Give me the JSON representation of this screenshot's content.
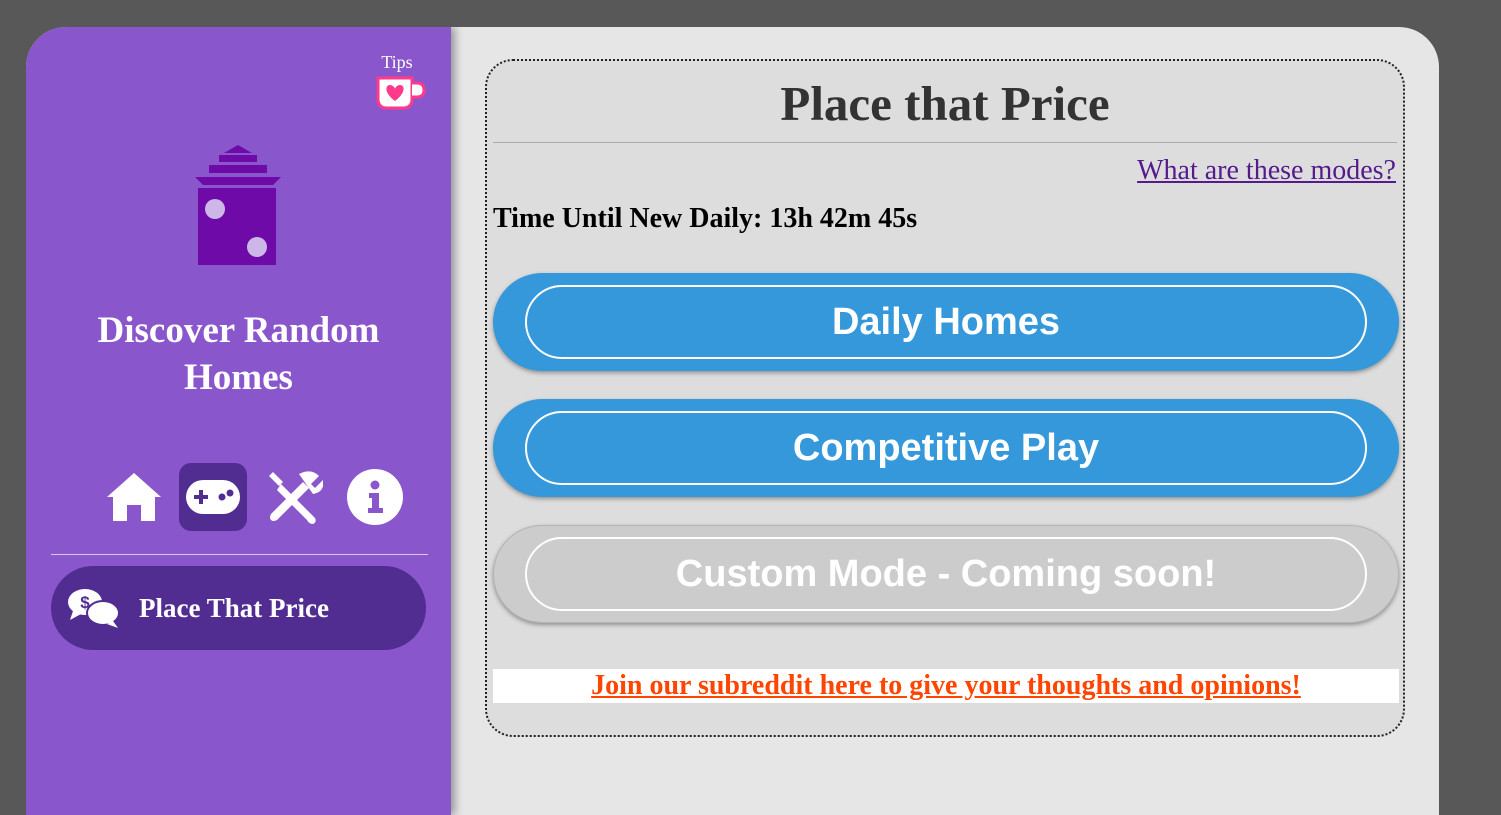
{
  "sidebar": {
    "tips_label": "Tips",
    "site_title_line1": "Discover Random",
    "site_title_line2": "Homes",
    "nav": [
      {
        "name": "home",
        "icon": "home-icon"
      },
      {
        "name": "games",
        "icon": "gamepad-icon",
        "active": true
      },
      {
        "name": "tools",
        "icon": "tools-icon"
      },
      {
        "name": "info",
        "icon": "info-icon"
      }
    ],
    "game_link": {
      "label": "Place That Price",
      "icon": "price-chat-icon"
    }
  },
  "main": {
    "title": "Place that Price",
    "modes_link": "What are these modes?",
    "timer": "Time Until New Daily: 13h 42m 45s",
    "buttons": [
      {
        "label": "Daily Homes",
        "state": "enabled"
      },
      {
        "label": "Competitive Play",
        "state": "enabled"
      },
      {
        "label": "Custom Mode - Coming soon!",
        "state": "disabled"
      }
    ],
    "subreddit_link": "Join our subreddit here to give your thoughts and opinions!"
  },
  "colors": {
    "sidebar": "#8a56cc",
    "sidebar_dark": "#522d91",
    "button_blue": "#3498db",
    "button_disabled": "#cccccc",
    "reddit_orange": "#ff4500",
    "logo_purple": "#6e0aa8"
  }
}
